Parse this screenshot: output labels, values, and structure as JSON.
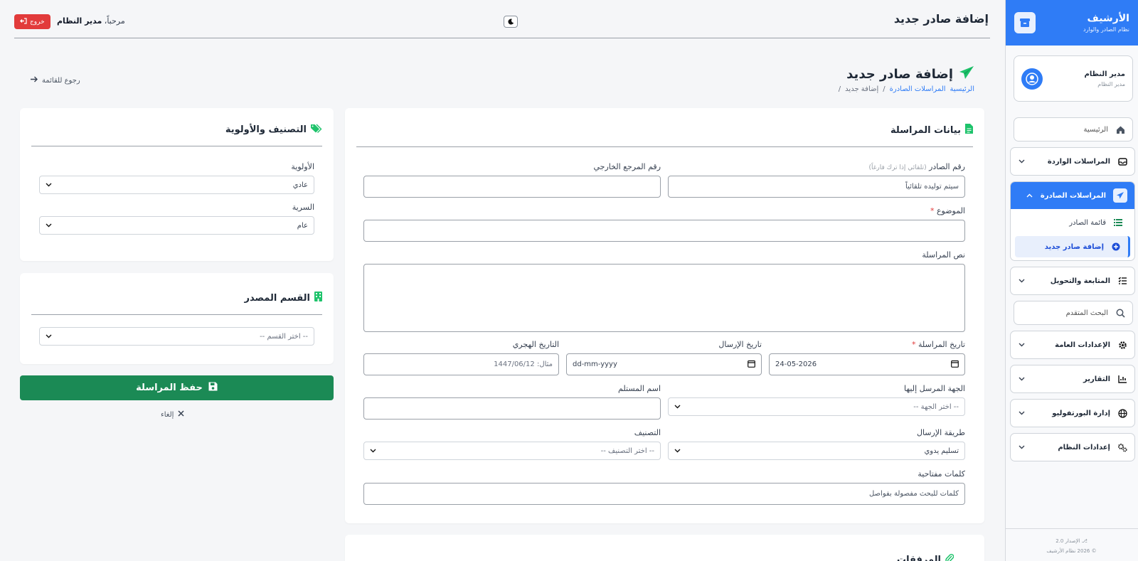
{
  "brand": {
    "title": "الأرشيف",
    "subtitle": "نظام الصادر والوارد"
  },
  "profile": {
    "name": "مدير النظام",
    "role": "مدير النظام"
  },
  "nav": {
    "home": "الرئيسية",
    "incoming": "المراسلات الواردة",
    "outgoing": "المراسلات الصادرة",
    "outgoing_list": "قائمة الصادر",
    "outgoing_add": "إضافة صادر جديد",
    "followup": "المتابعة والتحويل",
    "search": "البحث المتقدم",
    "general_settings": "الإعدادات العامة",
    "reports": "التقارير",
    "portfolio": "إدارة البورتفوليو",
    "system_settings": "إعدادات النظام"
  },
  "footer": {
    "version": "الإصدار 2.0",
    "copyright": "© 2026 نظام الأرشيف"
  },
  "topbar": {
    "title": "إضافة صادر جديد",
    "welcome_prefix": "مرحباً،",
    "welcome_name": "مدير النظام",
    "logout": "خروج"
  },
  "page": {
    "title": "إضافة صادر جديد",
    "breadcrumb_home": "الرئيسية",
    "breadcrumb_outgoing": "المراسلات الصادرة",
    "breadcrumb_sep": "/",
    "breadcrumb_current": "إضافة جديد",
    "breadcrumb_end": "/",
    "back": "رجوع للقائمة"
  },
  "form": {
    "section_title": "بيانات المراسلة",
    "outgoing_number_label": "رقم الصادر",
    "outgoing_number_hint": "(تلقائي إذا ترك فارغاً)",
    "outgoing_number_placeholder": "سيتم توليده تلقائياً",
    "external_ref_label": "رقم المرجع الخارجي",
    "subject_label": "الموضوع",
    "required_mark": "*",
    "body_label": "نص المراسلة",
    "date_label": "تاريخ المراسلة",
    "date_value": "24-05-2026",
    "send_date_label": "تاريخ الإرسال",
    "send_date_value": "dd-mm-yyyy",
    "hijri_label": "التاريخ الهجري",
    "hijri_placeholder": "مثال: 1447/06/12",
    "recipient_label": "الجهة المرسل إليها",
    "recipient_value": "-- اختر الجهة --",
    "receiver_name_label": "اسم المستلم",
    "send_method_label": "طريقة الإرسال",
    "send_method_value": "تسليم يدوي",
    "classification_label": "التصنيف",
    "classification_value": "-- اختر التصنيف --",
    "keywords_label": "كلمات مفتاحية",
    "keywords_placeholder": "كلمات للبحث مفصولة بفواصل"
  },
  "attachments": {
    "title": "المرفقات"
  },
  "priority_card": {
    "title": "التصنيف والأولوية",
    "priority_label": "الأولوية",
    "priority_value": "عادي",
    "secrecy_label": "السرية",
    "secrecy_value": "عام"
  },
  "department_card": {
    "title": "القسم المصدر",
    "department_value": "-- اختر القسم --"
  },
  "actions": {
    "save": "حفظ المراسلة",
    "cancel": "إلغاء"
  },
  "colors": {
    "primary": "#2f7cf6",
    "success": "#1b8a55",
    "danger": "#e23b3b",
    "tag": "#1ec36b"
  }
}
